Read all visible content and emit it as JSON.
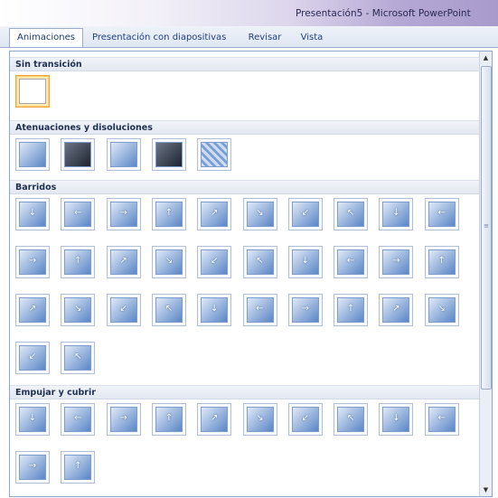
{
  "window": {
    "title": "Presentación5 - Microsoft PowerPoint"
  },
  "tabs": [
    "Animaciones",
    "Presentación con diapositivas",
    "Revisar",
    "Vista"
  ],
  "active_tab": "Animaciones",
  "scrollbar": {
    "position_fraction": 0.0
  },
  "sections": [
    {
      "title": "Sin transición",
      "count": 1,
      "selected_index": 0,
      "style": "white"
    },
    {
      "title": "Atenuaciones y disoluciones",
      "count": 5,
      "style": "fade"
    },
    {
      "title": "Barridos",
      "count": 32,
      "style": "wipe"
    },
    {
      "title": "Empujar y cubrir",
      "count": 12,
      "style": "push"
    }
  ],
  "icons": {
    "scroll_up": "triangle-up-icon",
    "scroll_down": "triangle-down-icon",
    "arrows": [
      "arrow-down-icon",
      "arrow-left-icon",
      "arrow-right-icon",
      "arrow-up-icon",
      "arrow-diagonal-icon"
    ]
  },
  "colors": {
    "title_gradient_end": "#a89bcc",
    "tab_text": "#20407a",
    "thumb_blue": "#5b86c6",
    "selected_fill": "#fde9b4",
    "selected_border": "#f0a83c"
  }
}
